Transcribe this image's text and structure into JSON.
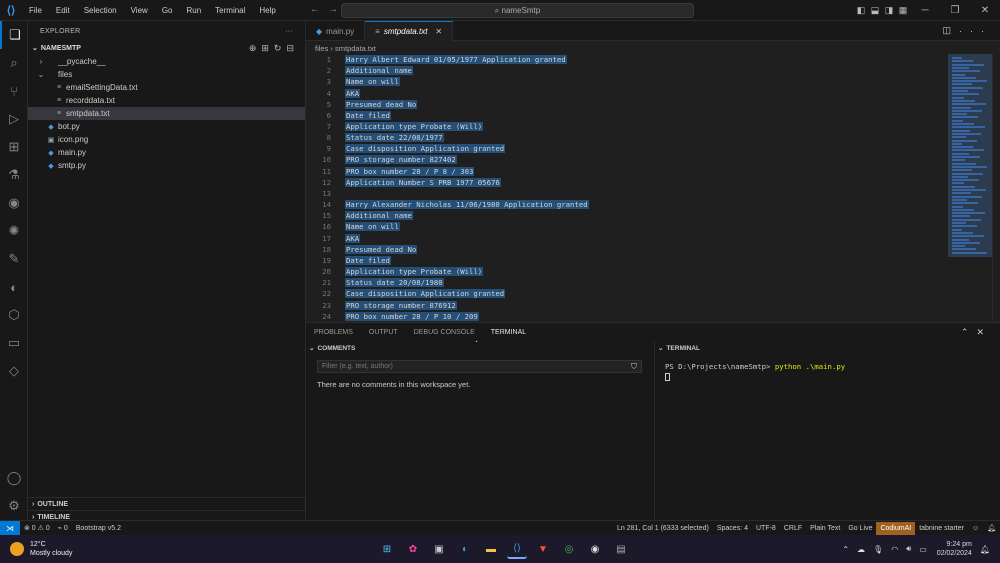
{
  "titlebar": {
    "menu": [
      "File",
      "Edit",
      "Selection",
      "View",
      "Go",
      "Run",
      "Terminal",
      "Help"
    ],
    "command_center": "⌕ nameSmtp"
  },
  "explorer": {
    "header": "EXPLORER",
    "project": "NAMESMTP",
    "tree": [
      {
        "label": "__pycache__",
        "depth": 1,
        "kind": "folder",
        "chev": "›",
        "icon": ""
      },
      {
        "label": "files",
        "depth": 1,
        "kind": "folder-open",
        "chev": "⌄",
        "icon": ""
      },
      {
        "label": "emailSettingData.txt",
        "depth": 2,
        "kind": "file",
        "chev": "",
        "icon": "≡"
      },
      {
        "label": "recorddata.txt",
        "depth": 2,
        "kind": "file",
        "chev": "",
        "icon": "≡"
      },
      {
        "label": "smtpdata.txt",
        "depth": 2,
        "kind": "file",
        "chev": "",
        "icon": "≡",
        "selected": true
      },
      {
        "label": "bot.py",
        "depth": 1,
        "kind": "file",
        "chev": "",
        "icon": "◆"
      },
      {
        "label": "icon.png",
        "depth": 1,
        "kind": "file",
        "chev": "",
        "icon": "▣"
      },
      {
        "label": "main.py",
        "depth": 1,
        "kind": "file",
        "chev": "",
        "icon": "◆"
      },
      {
        "label": "smtp.py",
        "depth": 1,
        "kind": "file",
        "chev": "",
        "icon": "◆"
      }
    ],
    "outline": "OUTLINE",
    "timeline": "TIMELINE"
  },
  "tabs": [
    {
      "label": "main.py",
      "active": false
    },
    {
      "label": "smtpdata.txt",
      "active": true
    }
  ],
  "breadcrumb": "files › smtpdata.txt",
  "editor_lines": [
    {
      "n": "1",
      "text": "Harry Albert Edward 01/05/1977 Application granted"
    },
    {
      "n": "2",
      "text": "Additional name"
    },
    {
      "n": "3",
      "text": "Name on will"
    },
    {
      "n": "4",
      "text": "AKA"
    },
    {
      "n": "5",
      "text": "Presumed dead No"
    },
    {
      "n": "6",
      "text": "Date filed"
    },
    {
      "n": "7",
      "text": "Application type Probate (Will)"
    },
    {
      "n": "8",
      "text": "Status date 22/08/1977"
    },
    {
      "n": "9",
      "text": "Case disposition Application granted"
    },
    {
      "n": "10",
      "text": "PRO storage number 827402"
    },
    {
      "n": "11",
      "text": "PRO box number 28 / P 8 / 303"
    },
    {
      "n": "12",
      "text": "Application Number S PRB 1977 05676"
    },
    {
      "n": "13",
      "text": ""
    },
    {
      "n": "14",
      "text": "Harry Alexander Nicholas 11/06/1980 Application granted"
    },
    {
      "n": "15",
      "text": "Additional name"
    },
    {
      "n": "16",
      "text": "Name on will"
    },
    {
      "n": "17",
      "text": "AKA"
    },
    {
      "n": "18",
      "text": "Presumed dead No"
    },
    {
      "n": "19",
      "text": "Date filed"
    },
    {
      "n": "20",
      "text": "Application type Probate (Will)"
    },
    {
      "n": "21",
      "text": "Status date 20/08/1980"
    },
    {
      "n": "22",
      "text": "Case disposition Application granted"
    },
    {
      "n": "23",
      "text": "PRO storage number 876912"
    },
    {
      "n": "24",
      "text": "PRO box number 28 / P 10 / 209"
    }
  ],
  "panel": {
    "tabs": [
      "PROBLEMS",
      "OUTPUT",
      "DEBUG CONSOLE",
      "TERMINAL"
    ],
    "active_tab": "TERMINAL",
    "comments_header": "COMMENTS",
    "filter_placeholder": "Filter (e.g. text, author)",
    "no_comments": "There are no comments in this workspace yet.",
    "terminal_header": "TERMINAL",
    "prompt": "PS D:\\Projects\\nameSmtp> ",
    "command": "python .\\main.py"
  },
  "statusbar": {
    "left": [
      "⊗ 0 ⚠ 0",
      "⌁ 0",
      "Bootstrap v5.2"
    ],
    "right": [
      "Ln 281, Col 1 (6333 selected)",
      "Spaces: 4",
      "UTF-8",
      "CRLF",
      "Plain Text",
      "Go Live",
      "CodiumAI",
      "tabnine starter"
    ]
  },
  "taskbar": {
    "temperature": "12°C",
    "condition": "Mostly cloudy",
    "time": "9:24 pm",
    "date": "02/02/2024"
  },
  "colors": {
    "accent": "#0078d4",
    "selection": "#264f78",
    "codium": "#a06020"
  }
}
